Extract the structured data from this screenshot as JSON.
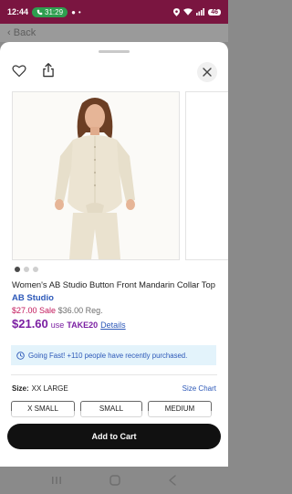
{
  "status_bar": {
    "time": "12:44",
    "call_timer": "31:29",
    "battery": "46"
  },
  "background": {
    "back_label": "Back"
  },
  "product": {
    "title": "Women's AB Studio Button Front Mandarin Collar Top",
    "brand": "AB Studio",
    "sale_price": "$27.00 Sale",
    "regular_price": "$36.00 Reg.",
    "promo_price": "$21.60",
    "promo_use": "use",
    "promo_code": "TAKE20",
    "promo_details": "Details",
    "image_count": 3,
    "active_image": 1
  },
  "alert": {
    "text": "Going Fast! +110 people have recently purchased."
  },
  "size": {
    "label": "Size:",
    "selected": "XX LARGE",
    "chart_link": "Size Chart",
    "options": [
      "X SMALL",
      "SMALL",
      "MEDIUM"
    ]
  },
  "cta": {
    "label": "Add to Cart"
  },
  "colors": {
    "status_bar": "#7a1540",
    "sale": "#c2185b",
    "promo": "#7b1fa2",
    "link": "#2c58b8",
    "cta": "#111111"
  }
}
